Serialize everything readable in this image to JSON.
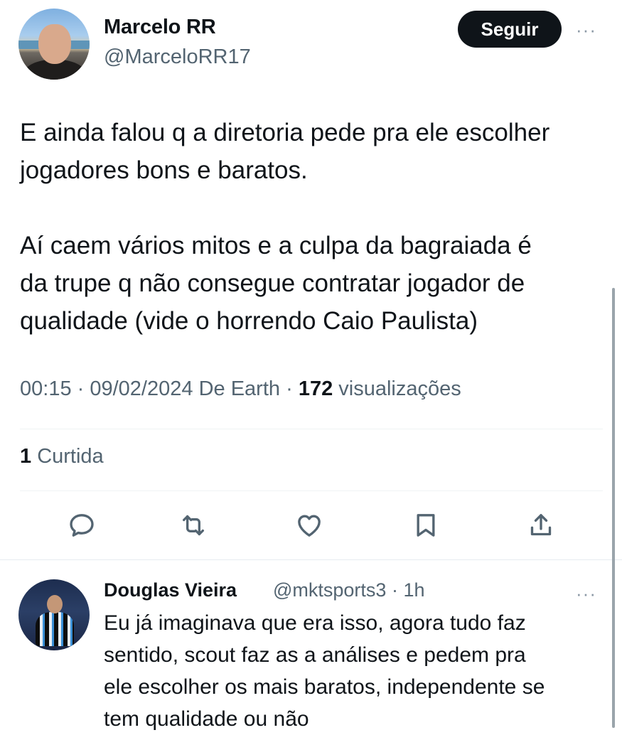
{
  "tweet": {
    "author_name": "Marcelo RR",
    "author_handle": "@MarceloRR17",
    "follow_label": "Seguir",
    "more_label": "···",
    "text_lines": [
      "E ainda falou q a diretoria pede pra ele escolher",
      "jogadores bons e baratos.",
      "Aí caem vários mitos e a culpa da bagraiada é",
      "da trupe q não consegue contratar jogador de",
      "qualidade (vide o horrendo Caio Paulista)"
    ],
    "time": "00:15",
    "date": "09/02/2024",
    "source": "De Earth",
    "views_count": "172",
    "views_label": "visualizações",
    "likes_count": "1",
    "likes_label": "Curtida"
  },
  "actions": [
    {
      "name": "reply",
      "icon": "reply-icon"
    },
    {
      "name": "retweet",
      "icon": "retweet-icon"
    },
    {
      "name": "like",
      "icon": "heart-icon"
    },
    {
      "name": "bookmark",
      "icon": "bookmark-icon"
    },
    {
      "name": "share",
      "icon": "share-icon"
    }
  ],
  "reply": {
    "author_name": "Douglas Vieira",
    "author_handle": "@mktsports3",
    "time_ago": "1h",
    "more_label": "···",
    "text_lines": [
      "Eu já imaginava que era isso, agora tudo faz",
      "sentido, scout faz as a análises e pedem pra",
      "ele escolher os mais baratos, independente se",
      "tem qualidade ou não"
    ]
  },
  "colors": {
    "text": "#0f1419",
    "secondary": "#536471",
    "icon": "#536471",
    "follow_bg": "#0f1419",
    "divider": "#eff3f4"
  }
}
